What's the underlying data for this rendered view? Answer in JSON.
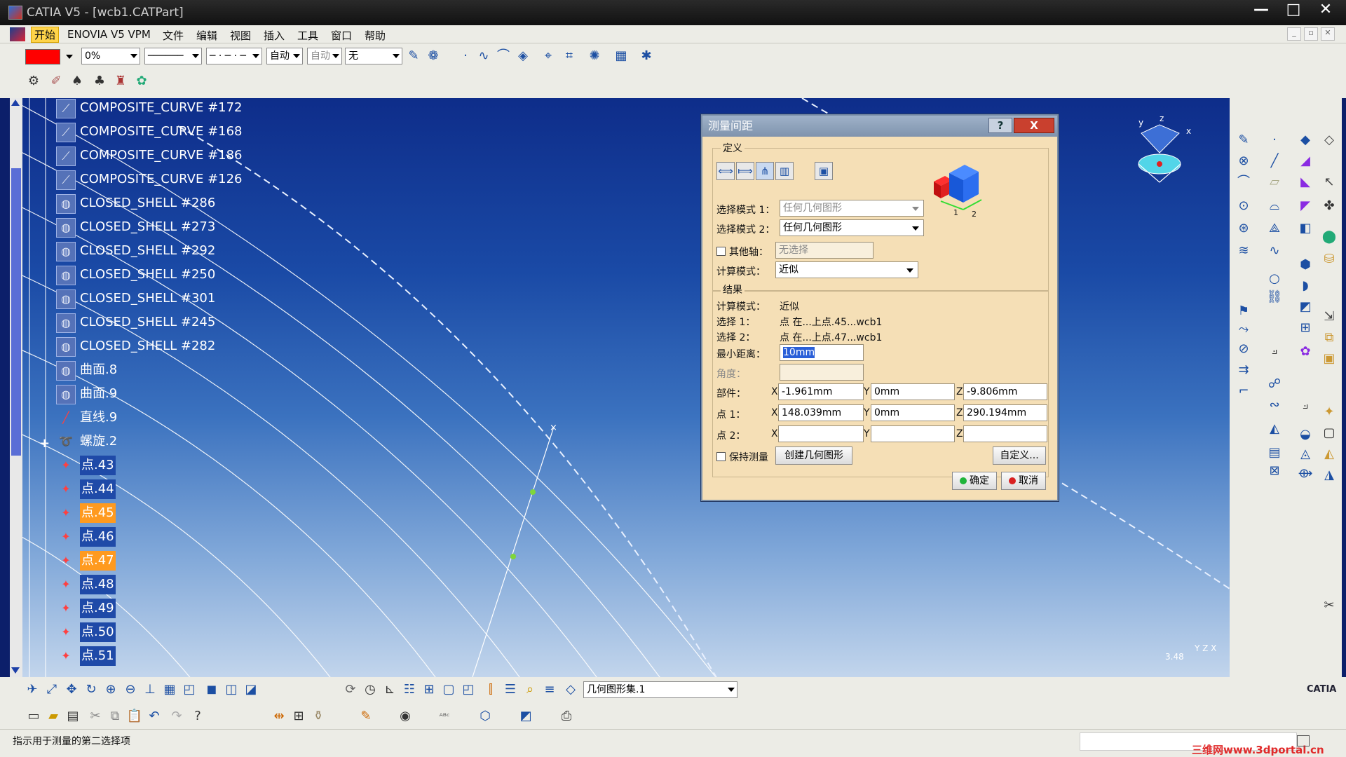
{
  "window": {
    "title": "CATIA V5 - [wcb1.CATPart]"
  },
  "menubar": {
    "items": [
      "开始",
      "ENOVIA V5 VPM",
      "文件",
      "编辑",
      "视图",
      "插入",
      "工具",
      "窗口",
      "帮助"
    ]
  },
  "top_toolbar": {
    "color_swatch": "#ff0000",
    "transparency": "0%",
    "line_type_1": "──────",
    "line_type_2": "─ · ─ · ─",
    "weight": "自动",
    "layer": "自动",
    "render": "无"
  },
  "tree": {
    "items": [
      {
        "label": "COMPOSITE_CURVE #172",
        "icon": "curve-icon",
        "state": "normal"
      },
      {
        "label": "COMPOSITE_CURVE #168",
        "icon": "curve-icon",
        "state": "normal"
      },
      {
        "label": "COMPOSITE_CURVE #186",
        "icon": "curve-icon",
        "state": "normal"
      },
      {
        "label": "COMPOSITE_CURVE #126",
        "icon": "curve-icon",
        "state": "normal"
      },
      {
        "label": "CLOSED_SHELL #286",
        "icon": "shell-icon",
        "state": "normal"
      },
      {
        "label": "CLOSED_SHELL #273",
        "icon": "shell-icon",
        "state": "normal"
      },
      {
        "label": "CLOSED_SHELL #292",
        "icon": "shell-icon",
        "state": "normal"
      },
      {
        "label": "CLOSED_SHELL #250",
        "icon": "shell-icon",
        "state": "normal"
      },
      {
        "label": "CLOSED_SHELL #301",
        "icon": "shell-icon",
        "state": "normal"
      },
      {
        "label": "CLOSED_SHELL #245",
        "icon": "shell-icon",
        "state": "normal"
      },
      {
        "label": "CLOSED_SHELL #282",
        "icon": "shell-icon",
        "state": "normal"
      },
      {
        "label": "曲面.8",
        "icon": "surface-icon",
        "state": "normal"
      },
      {
        "label": "曲面.9",
        "icon": "surface-icon",
        "state": "normal"
      },
      {
        "label": "直线.9",
        "icon": "line-icon",
        "state": "normal"
      },
      {
        "label": "螺旋.2",
        "icon": "helix-icon",
        "state": "normal"
      },
      {
        "label": "点.43",
        "icon": "point-icon",
        "state": "selected"
      },
      {
        "label": "点.44",
        "icon": "point-icon",
        "state": "selected"
      },
      {
        "label": "点.45",
        "icon": "point-icon",
        "state": "highlight"
      },
      {
        "label": "点.46",
        "icon": "point-icon",
        "state": "selected"
      },
      {
        "label": "点.47",
        "icon": "point-icon",
        "state": "highlight"
      },
      {
        "label": "点.48",
        "icon": "point-icon",
        "state": "selected"
      },
      {
        "label": "点.49",
        "icon": "point-icon",
        "state": "selected"
      },
      {
        "label": "点.50",
        "icon": "point-icon",
        "state": "selected"
      },
      {
        "label": "点.51",
        "icon": "point-icon",
        "state": "selected"
      }
    ]
  },
  "dialog": {
    "title": "测量间距",
    "help_btn": "?",
    "close_btn": "X",
    "definition_label": "定义",
    "select_mode1_label": "选择模式 1：",
    "select_mode1_value": "任何几何图形",
    "select_mode2_label": "选择模式 2：",
    "select_mode2_value": "任何几何图形",
    "other_axis_label": "其他轴：",
    "other_axis_value": "无选择",
    "calc_mode_label": "计算模式：",
    "calc_mode_value": "近似",
    "result_label": "结果",
    "res_calc_mode_label": "计算模式：",
    "res_calc_mode_value": "近似",
    "sel1_label": "选择 1：",
    "sel1_value": "点 在...上点.45...wcb1",
    "sel2_label": "选择 2：",
    "sel2_value": "点 在...上点.47...wcb1",
    "min_dist_label": "最小距离：",
    "min_dist_value": "10mm",
    "angle_label": "角度：",
    "part_label": "部件：",
    "part_x": "-1.961mm",
    "part_y": "0mm",
    "part_z": "-9.806mm",
    "pt1_label": "点 1：",
    "pt1_x": "148.039mm",
    "pt1_y": "0mm",
    "pt1_z": "290.194mm",
    "pt2_label": "点 2：",
    "x_label": "X",
    "y_label": "Y",
    "z_label": "Z",
    "keep_measure_label": "保持测量",
    "create_geom_btn": "创建几何图形",
    "customize_btn": "自定义...",
    "ok_btn": "确定",
    "cancel_btn": "取消",
    "cube_label_1": "1",
    "cube_label_2": "2"
  },
  "bottom_toolbar": {
    "geom_set_value": "几何图形集.1"
  },
  "viewport": {
    "compass_x": "x",
    "compass_y": "y",
    "compass_z": "z",
    "scale_text": "3.48",
    "axis_text": "Y Z X"
  },
  "status": {
    "text": "指示用于测量的第二选择项",
    "watermark": "三维网www.3dportal.cn",
    "brand": "CATIA"
  }
}
